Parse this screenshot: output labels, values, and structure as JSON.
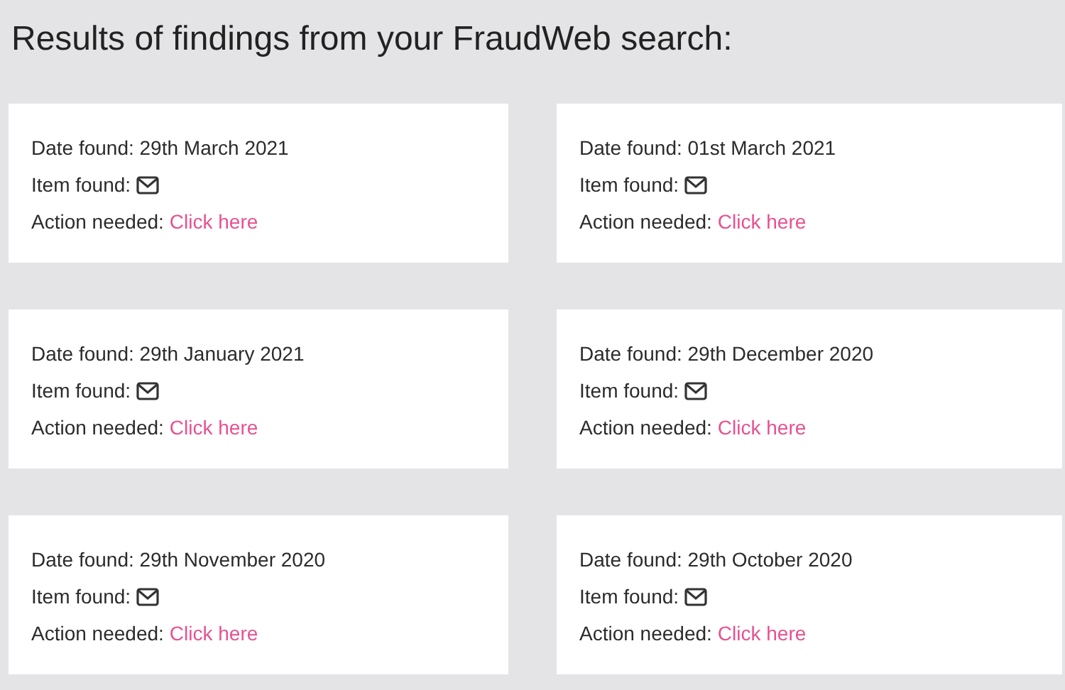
{
  "heading": "Results of findings from your FraudWeb search:",
  "results": [
    {
      "date_label": "Date found:",
      "date": "29th March 2021",
      "item_label": "Item found:",
      "action_label": "Action needed:",
      "link": "Click here"
    },
    {
      "date_label": "Date found:",
      "date": "01st March 2021",
      "item_label": "Item found:",
      "action_label": "Action needed:",
      "link": "Click here"
    },
    {
      "date_label": "Date found:",
      "date": "29th January 2021",
      "item_label": "Item found:",
      "action_label": "Action needed:",
      "link": "Click here"
    },
    {
      "date_label": "Date found:",
      "date": "29th December 2020",
      "item_label": "Item found:",
      "action_label": "Action needed:",
      "link": "Click here"
    },
    {
      "date_label": "Date found:",
      "date": "29th November 2020",
      "item_label": "Item found:",
      "action_label": "Action needed:",
      "link": "Click here"
    },
    {
      "date_label": "Date found:",
      "date": "29th October 2020",
      "item_label": "Item found:",
      "action_label": "Action needed:",
      "link": "Click here"
    }
  ]
}
